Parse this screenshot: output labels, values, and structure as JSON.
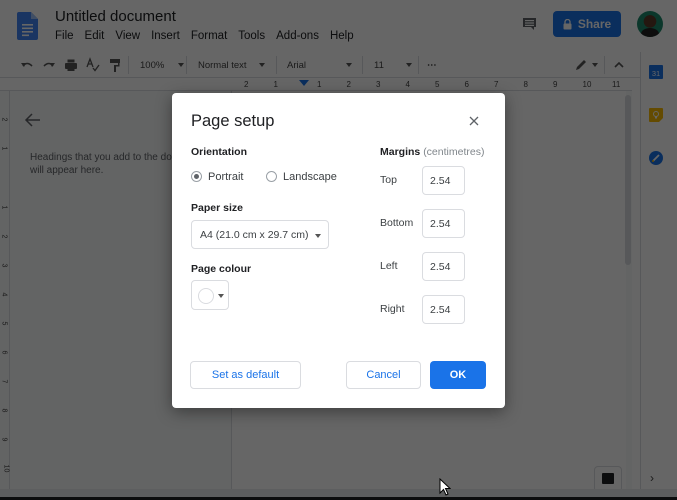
{
  "header": {
    "title": "Untitled document",
    "menu": [
      "File",
      "Edit",
      "View",
      "Insert",
      "Format",
      "Tools",
      "Add-ons",
      "Help"
    ],
    "share_label": "Share",
    "icons": {
      "logo": "docs-logo-icon",
      "comments": "comment-icon",
      "share_lock": "lock-icon",
      "avatar": "user-avatar"
    }
  },
  "toolbar": {
    "zoom": "100%",
    "style": "Normal text",
    "font": "Arial",
    "font_size": "11",
    "more": "⋯",
    "icons": [
      "undo-icon",
      "redo-icon",
      "print-icon",
      "spellcheck-icon",
      "paint-format-icon",
      "edit-mode-icon",
      "collapse-icon"
    ]
  },
  "ruler": {
    "horizontal": [
      "2",
      "1",
      "1",
      "2",
      "3",
      "4",
      "5",
      "6",
      "7",
      "8",
      "9",
      "10",
      "11"
    ],
    "vertical": [
      "2",
      "1",
      "1",
      "2",
      "3",
      "4",
      "5",
      "6",
      "7",
      "8",
      "9",
      "10"
    ]
  },
  "outline": {
    "text_line1": "Headings that you add to the document",
    "text_line2": "will appear here."
  },
  "side_panel": {
    "icons": [
      "calendar-icon",
      "keep-icon",
      "tasks-icon"
    ],
    "calendar_text": "31",
    "colors": {
      "calendar": "#1a73e8",
      "keep": "#fbbc04",
      "tasks": "#1a73e8"
    }
  },
  "dialog": {
    "title": "Page setup",
    "orientation": {
      "label": "Orientation",
      "options": [
        "Portrait",
        "Landscape"
      ],
      "selected": "Portrait"
    },
    "paper_size": {
      "label": "Paper size",
      "value": "A4 (21.0 cm x 29.7 cm)"
    },
    "page_colour": {
      "label": "Page colour",
      "value": "#ffffff"
    },
    "margins": {
      "label": "Margins",
      "unit": "(centimetres)",
      "fields": [
        {
          "label": "Top",
          "value": "2.54"
        },
        {
          "label": "Bottom",
          "value": "2.54"
        },
        {
          "label": "Left",
          "value": "2.54"
        },
        {
          "label": "Right",
          "value": "2.54"
        }
      ]
    },
    "buttons": {
      "set_default": "Set as default",
      "cancel": "Cancel",
      "ok": "OK"
    }
  },
  "colors": {
    "accent": "#1a73e8",
    "overlay": "rgba(0,0,0,0.6)"
  }
}
